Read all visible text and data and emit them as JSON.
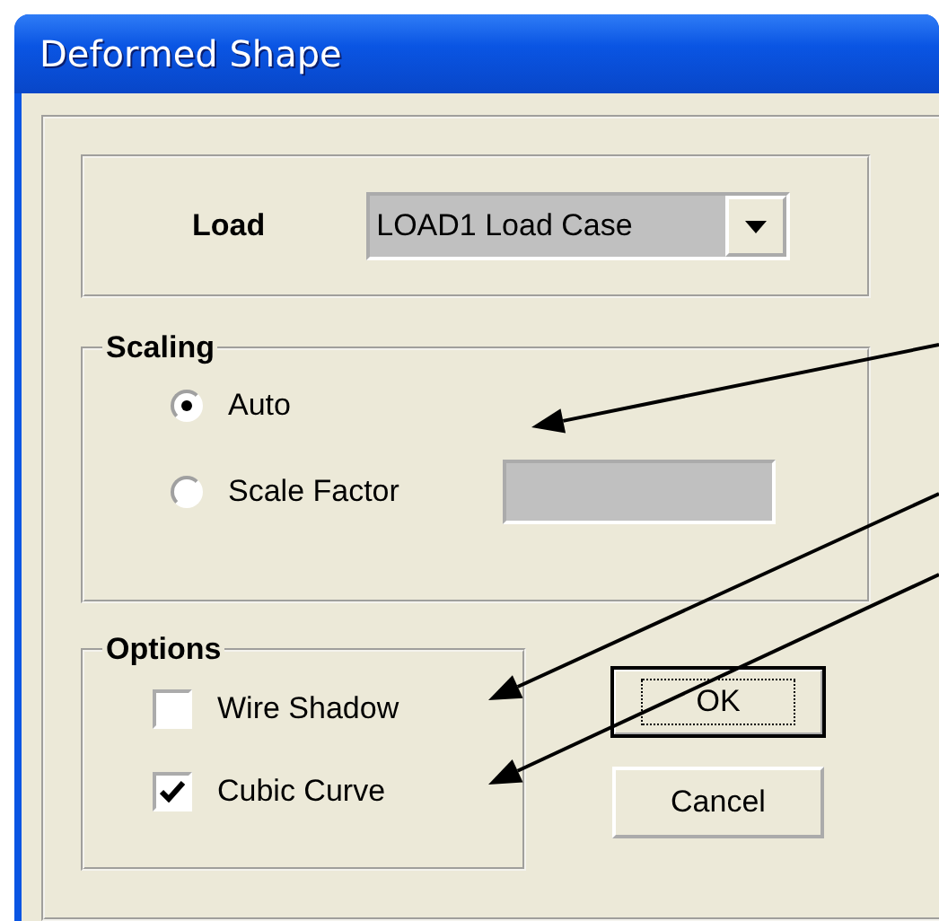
{
  "window": {
    "title": "Deformed Shape"
  },
  "load": {
    "label": "Load",
    "value": "LOAD1 Load Case"
  },
  "scaling": {
    "title": "Scaling",
    "options": [
      {
        "label": "Auto",
        "selected": true
      },
      {
        "label": "Scale Factor",
        "selected": false
      }
    ],
    "scale_factor_field": {
      "disabled": true
    }
  },
  "options": {
    "title": "Options",
    "items": [
      {
        "label": "Wire Shadow",
        "checked": false
      },
      {
        "label": "Cubic Curve",
        "checked": true
      }
    ]
  },
  "buttons": [
    {
      "label": "OK",
      "default": true
    },
    {
      "label": "Cancel",
      "default": false
    }
  ]
}
